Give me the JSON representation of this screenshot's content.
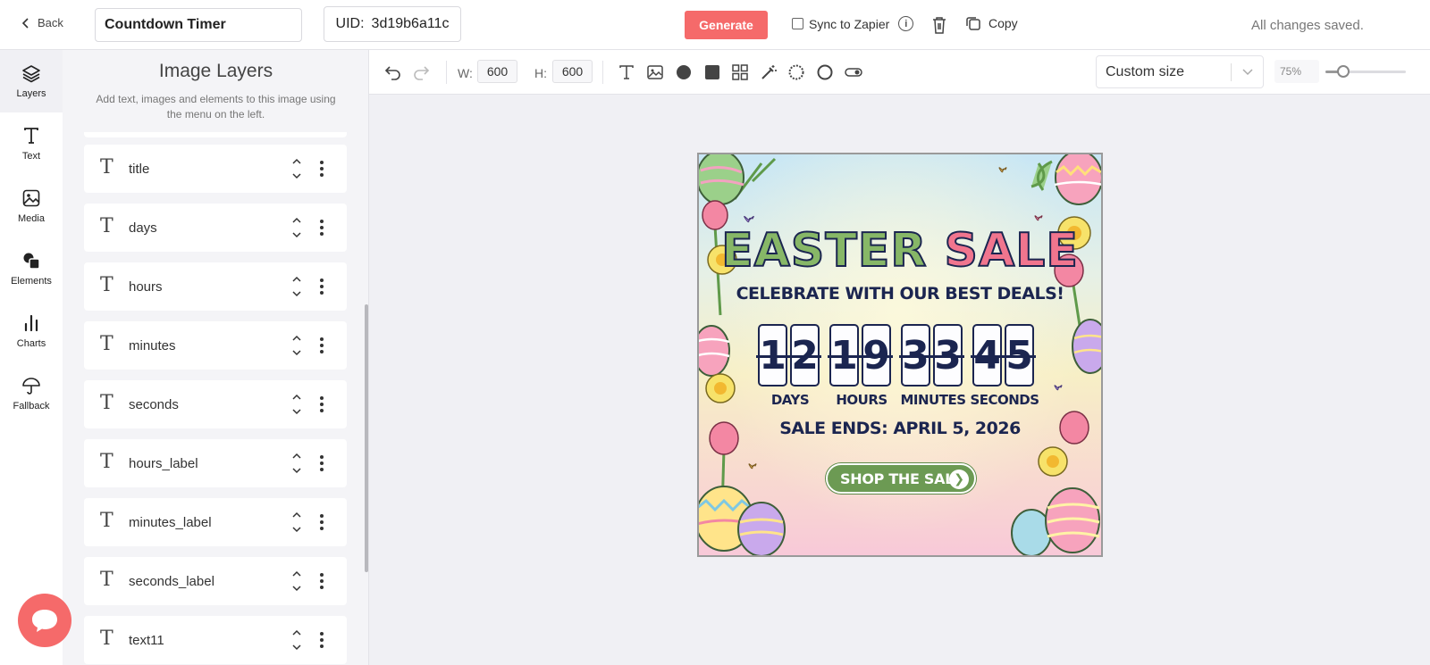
{
  "topbar": {
    "back_label": "Back",
    "project_name": "Countdown Timer",
    "uid_label": "UID:",
    "uid_value": "3d19b6a11c",
    "generate_label": "Generate",
    "sync_label": "Sync to Zapier",
    "copy_label": "Copy",
    "status": "All changes saved."
  },
  "rail": {
    "items": [
      {
        "label": "Layers",
        "icon": "layers-icon"
      },
      {
        "label": "Text",
        "icon": "text-icon"
      },
      {
        "label": "Media",
        "icon": "image-icon"
      },
      {
        "label": "Elements",
        "icon": "shapes-icon"
      },
      {
        "label": "Charts",
        "icon": "bar-chart-icon"
      },
      {
        "label": "Fallback",
        "icon": "umbrella-icon"
      }
    ]
  },
  "panel": {
    "title": "Image Layers",
    "subtitle": "Add text, images and elements to this image using the menu on the left.",
    "layers": [
      {
        "name": "title"
      },
      {
        "name": "days"
      },
      {
        "name": "hours"
      },
      {
        "name": "minutes"
      },
      {
        "name": "seconds"
      },
      {
        "name": "hours_label"
      },
      {
        "name": "minutes_label"
      },
      {
        "name": "seconds_label"
      },
      {
        "name": "text11"
      }
    ]
  },
  "toolbar": {
    "width_label": "W:",
    "width_value": "600",
    "height_label": "H:",
    "height_value": "600",
    "size_preset": "Custom size",
    "zoom": "75%",
    "zoom_fraction": 0.22
  },
  "banner": {
    "title_word1": "EASTER",
    "title_word2": "SALE",
    "tagline": "CELEBRATE WITH OUR BEST DEALS!",
    "days": "12",
    "hours": "19",
    "minutes": "33",
    "seconds": "45",
    "days_label": "DAYS",
    "hours_label": "HOURS",
    "minutes_label": "MINUTES",
    "seconds_label": "SECONDS",
    "sale_ends": "SALE ENDS: APRIL 5, 2026",
    "cta": "SHOP THE SALE"
  },
  "colors": {
    "accent": "#f56a6a",
    "banner_navy": "#1b2550",
    "banner_green": "#87b767",
    "banner_pink": "#f0758e",
    "cta_green": "#6c9a53"
  }
}
